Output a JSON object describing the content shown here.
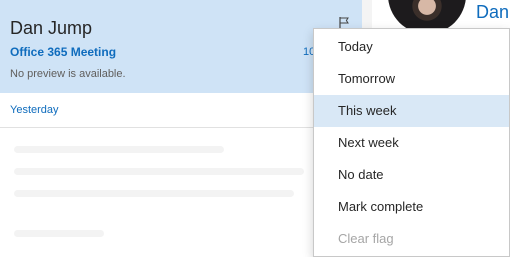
{
  "message": {
    "sender": "Dan Jump",
    "subject": "Office 365 Meeting",
    "preview": "No preview is available.",
    "time_partial": "10"
  },
  "list": {
    "group_header": "Yesterday"
  },
  "reading_pane": {
    "name_partial": "Dan"
  },
  "flag_menu": {
    "items": [
      {
        "label": "Today",
        "state": "normal"
      },
      {
        "label": "Tomorrow",
        "state": "normal"
      },
      {
        "label": "This week",
        "state": "hover"
      },
      {
        "label": "Next week",
        "state": "normal"
      },
      {
        "label": "No date",
        "state": "normal"
      },
      {
        "label": "Mark complete",
        "state": "normal"
      },
      {
        "label": "Clear flag",
        "state": "disabled"
      }
    ]
  },
  "colors": {
    "accent": "#0f6cbd",
    "selected_row": "#cfe3f6",
    "menu_hover": "#d9e8f6",
    "disabled_text": "#a6a6a6"
  },
  "icons": {
    "flag": "flag-icon"
  }
}
